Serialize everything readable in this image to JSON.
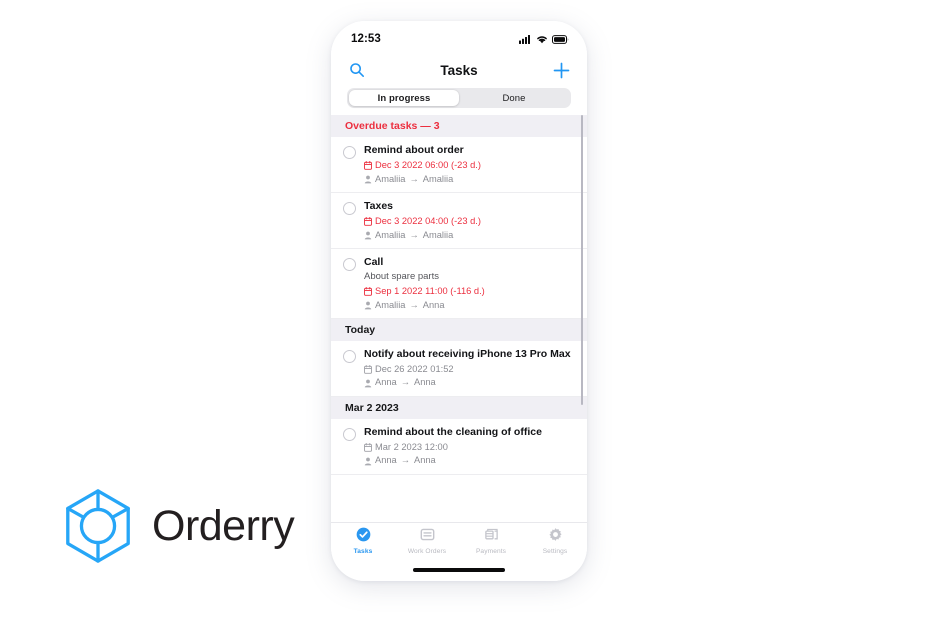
{
  "brand": {
    "name": "Orderry",
    "logo_icon": "orderry-cube-logo",
    "color": "#26A6F7"
  },
  "phone": {
    "status_bar": {
      "time": "12:53",
      "icons": [
        "cellular-signal-icon",
        "wifi-icon",
        "battery-icon"
      ]
    },
    "nav": {
      "title": "Tasks",
      "search_icon": "search-icon",
      "add_icon": "plus-icon",
      "accent_color": "#2196F3"
    },
    "segmented": {
      "options": [
        "In progress",
        "Done"
      ],
      "selected": "In progress"
    },
    "sections": [
      {
        "title": "Overdue tasks — 3",
        "overdue": true,
        "tasks": [
          {
            "title": "Remind about order",
            "subtitle": "",
            "due": "Dec 3 2022 06:00 (-23 d.)",
            "overdue": true,
            "assigner": "Amaliia",
            "assignee": "Amaliia"
          },
          {
            "title": "Taxes",
            "subtitle": "",
            "due": "Dec 3 2022 04:00 (-23 d.)",
            "overdue": true,
            "assigner": "Amaliia",
            "assignee": "Amaliia"
          },
          {
            "title": "Call",
            "subtitle": "About spare parts",
            "due": "Sep 1 2022 11:00 (-116 d.)",
            "overdue": true,
            "assigner": "Amaliia",
            "assignee": "Anna"
          }
        ]
      },
      {
        "title": "Today",
        "overdue": false,
        "tasks": [
          {
            "title": "Notify about receiving iPhone 13 Pro Max",
            "subtitle": "",
            "due": "Dec 26 2022 01:52",
            "overdue": false,
            "assigner": "Anna",
            "assignee": "Anna"
          }
        ]
      },
      {
        "title": "Mar 2 2023",
        "overdue": false,
        "tasks": [
          {
            "title": "Remind about the cleaning of office",
            "subtitle": "",
            "due": "Mar 2 2023 12:00",
            "overdue": false,
            "assigner": "Anna",
            "assignee": "Anna"
          }
        ]
      }
    ],
    "tabs": [
      {
        "label": "Tasks",
        "icon": "check-circle-icon",
        "active": true
      },
      {
        "label": "Work Orders",
        "icon": "work-order-icon",
        "active": false
      },
      {
        "label": "Payments",
        "icon": "payments-icon",
        "active": false
      },
      {
        "label": "Settings",
        "icon": "gear-icon",
        "active": false
      }
    ],
    "meta_icons": {
      "calendar": "calendar-icon",
      "person": "person-icon",
      "arrow": "→"
    }
  }
}
